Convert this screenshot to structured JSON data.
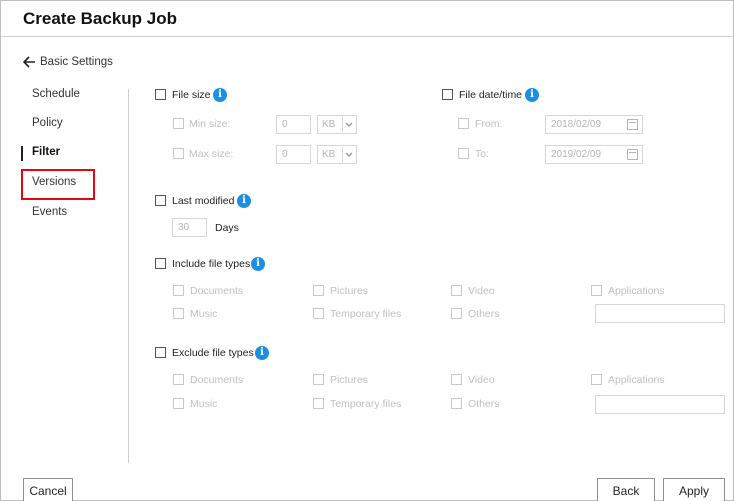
{
  "dialog": {
    "title": "Create Backup Job"
  },
  "back": {
    "label": "Basic Settings"
  },
  "nav": {
    "items": [
      {
        "label": "Schedule"
      },
      {
        "label": "Policy"
      },
      {
        "label": "Filter"
      },
      {
        "label": "Versions"
      },
      {
        "label": "Events"
      }
    ],
    "active": "Filter",
    "highlighted": "Versions"
  },
  "filter": {
    "file_size": {
      "label": "File size",
      "min_label": "Min size:",
      "min_value": "0",
      "max_label": "Max size:",
      "max_value": "0",
      "unit": "KB"
    },
    "file_date": {
      "label": "File date/time",
      "from_label": "From:",
      "from_value": "2018/02/09",
      "to_label": "To:",
      "to_value": "2019/02/09"
    },
    "last_modified": {
      "label": "Last modified",
      "days_value": "30",
      "days_label": "Days"
    },
    "include": {
      "label": "Include file types",
      "types": [
        "Documents",
        "Pictures",
        "Video",
        "Applications",
        "Music",
        "Temporary files",
        "Others"
      ]
    },
    "exclude": {
      "label": "Exclude file types",
      "types": [
        "Documents",
        "Pictures",
        "Video",
        "Applications",
        "Music",
        "Temporary files",
        "Others"
      ]
    }
  },
  "footer": {
    "cancel": "Cancel",
    "back": "Back",
    "apply": "Apply"
  },
  "colors": {
    "info": "#1a8fe3",
    "highlight": "#e30613"
  }
}
